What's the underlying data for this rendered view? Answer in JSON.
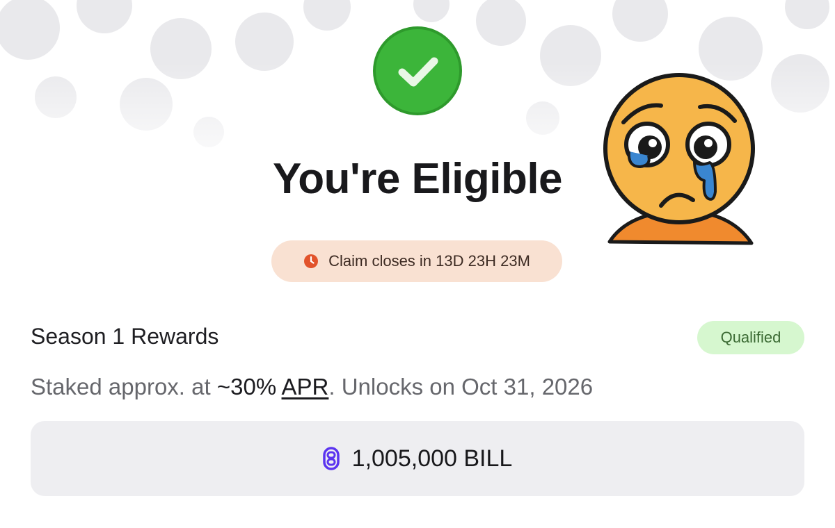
{
  "header": {
    "title": "You're Eligible",
    "success_icon": "check-circle-icon"
  },
  "countdown": {
    "icon": "clock-icon",
    "text": "Claim closes in 13D 23H 23M"
  },
  "season": {
    "title": "Season 1 Rewards",
    "badge": "Qualified",
    "staked_prefix": "Staked approx. at ",
    "apr_value": "~30%",
    "apr_link": "APR",
    "unlock_text": ". Unlocks on Oct 31, 2026"
  },
  "reward": {
    "token_icon": "bill-token-icon",
    "amount": "1,005,000 BILL"
  },
  "overlay": {
    "emoji": "crying-face-icon"
  },
  "colors": {
    "success_green": "#3cb53a",
    "countdown_bg": "#f9e1d2",
    "countdown_icon": "#e2532b",
    "qualified_bg": "#d6f7cf",
    "qualified_text": "#3b6a33",
    "token_purple": "#5b34f0",
    "emoji_yellow": "#f6b64a",
    "tear_blue": "#3a86d0"
  }
}
